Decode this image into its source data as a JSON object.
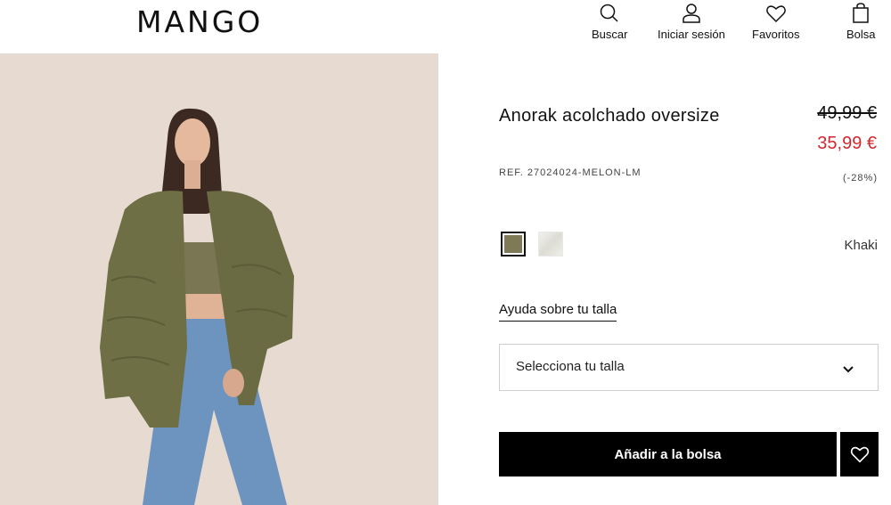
{
  "header": {
    "logo": "MANGO",
    "nav": {
      "search": "Buscar",
      "login": "Iniciar sesión",
      "favorites": "Favoritos",
      "bag": "Bolsa"
    }
  },
  "product": {
    "title": "Anorak acolchado oversize",
    "old_price": "49,99 €",
    "new_price": "35,99 €",
    "ref": "REF. 27024024-MELON-LM",
    "discount": "(-28%)",
    "color_name": "Khaki",
    "size_help": "Ayuda sobre tu talla",
    "size_select": "Selecciona tu talla",
    "add_to_bag": "Añadir a la bolsa"
  },
  "colors": {
    "sale": "#d0282e",
    "khaki": "#7e7a57",
    "background_image": "#e6dad1"
  },
  "icons": [
    "search-icon",
    "user-icon",
    "heart-icon",
    "bag-icon",
    "chevron-down-icon",
    "heart-icon"
  ]
}
